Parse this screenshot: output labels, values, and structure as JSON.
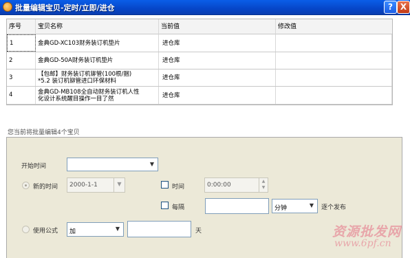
{
  "window": {
    "title": "批量编辑宝贝-定时/立即/进仓",
    "help_label": "?",
    "close_label": "X"
  },
  "table": {
    "columns": [
      "序号",
      "宝贝名称",
      "当前值",
      "修改值"
    ],
    "rows": [
      {
        "index": "1",
        "name": "金典GD-XC103财务装订机垫片",
        "current": "进仓库",
        "new": ""
      },
      {
        "index": "2",
        "name": "金典GD-50A财务装订机垫片",
        "current": "进仓库",
        "new": ""
      },
      {
        "index": "3",
        "name": "【包邮】财务装订机铆管(100根/捆)\n*5.2 装订机铆管进口环保材料",
        "current": "进仓库",
        "new": ""
      },
      {
        "index": "4",
        "name": "金典GD-MB108全自动财务装订机人性\n化设计系统醒目操作一目了然",
        "current": "进仓库",
        "new": ""
      }
    ]
  },
  "status": {
    "count_text": "您当前将批量编辑4个宝贝"
  },
  "form": {
    "start_time_label": "开始时间",
    "start_time_value": "",
    "new_time_label": "新的时间",
    "new_time_value": "2000-1-1",
    "time_label": "时间",
    "time_value": "0:00:00",
    "interval_label": "每隔",
    "interval_value": "",
    "interval_unit": "分钟",
    "interval_suffix": "逐个发布",
    "formula_label": "使用公式",
    "formula_op": "加",
    "formula_value": "",
    "formula_unit": "天"
  },
  "watermark": {
    "text": "资源批发网",
    "url": "www.6pf.cn"
  },
  "colors": {
    "titlebar": "#0646c8",
    "panel": "#ece9d8",
    "watermark": "#e8a6aa"
  }
}
